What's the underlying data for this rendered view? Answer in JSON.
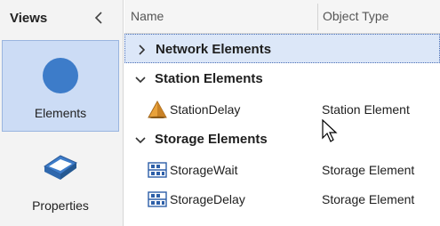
{
  "views_panel": {
    "title": "Views",
    "items": [
      {
        "label": "Elements",
        "icon": "blue-circle-icon",
        "active": true
      },
      {
        "label": "Properties",
        "icon": "box-icon",
        "active": false
      }
    ]
  },
  "grid": {
    "columns": [
      "Name",
      "Object Type"
    ],
    "groups": [
      {
        "label": "Network Elements",
        "expanded": false,
        "selected": true,
        "rows": []
      },
      {
        "label": "Station Elements",
        "expanded": true,
        "selected": false,
        "rows": [
          {
            "name": "StationDelay",
            "type": "Station Element",
            "icon": "station-cone-icon"
          }
        ]
      },
      {
        "label": "Storage Elements",
        "expanded": true,
        "selected": false,
        "rows": [
          {
            "name": "StorageWait",
            "type": "Storage Element",
            "icon": "storage-rack-icon"
          },
          {
            "name": "StorageDelay",
            "type": "Storage Element",
            "icon": "storage-rack-icon"
          }
        ]
      }
    ]
  },
  "colors": {
    "accent": "#3d7cc9",
    "selection": "#ccdcf5",
    "group_selected": "#dce7f8"
  }
}
